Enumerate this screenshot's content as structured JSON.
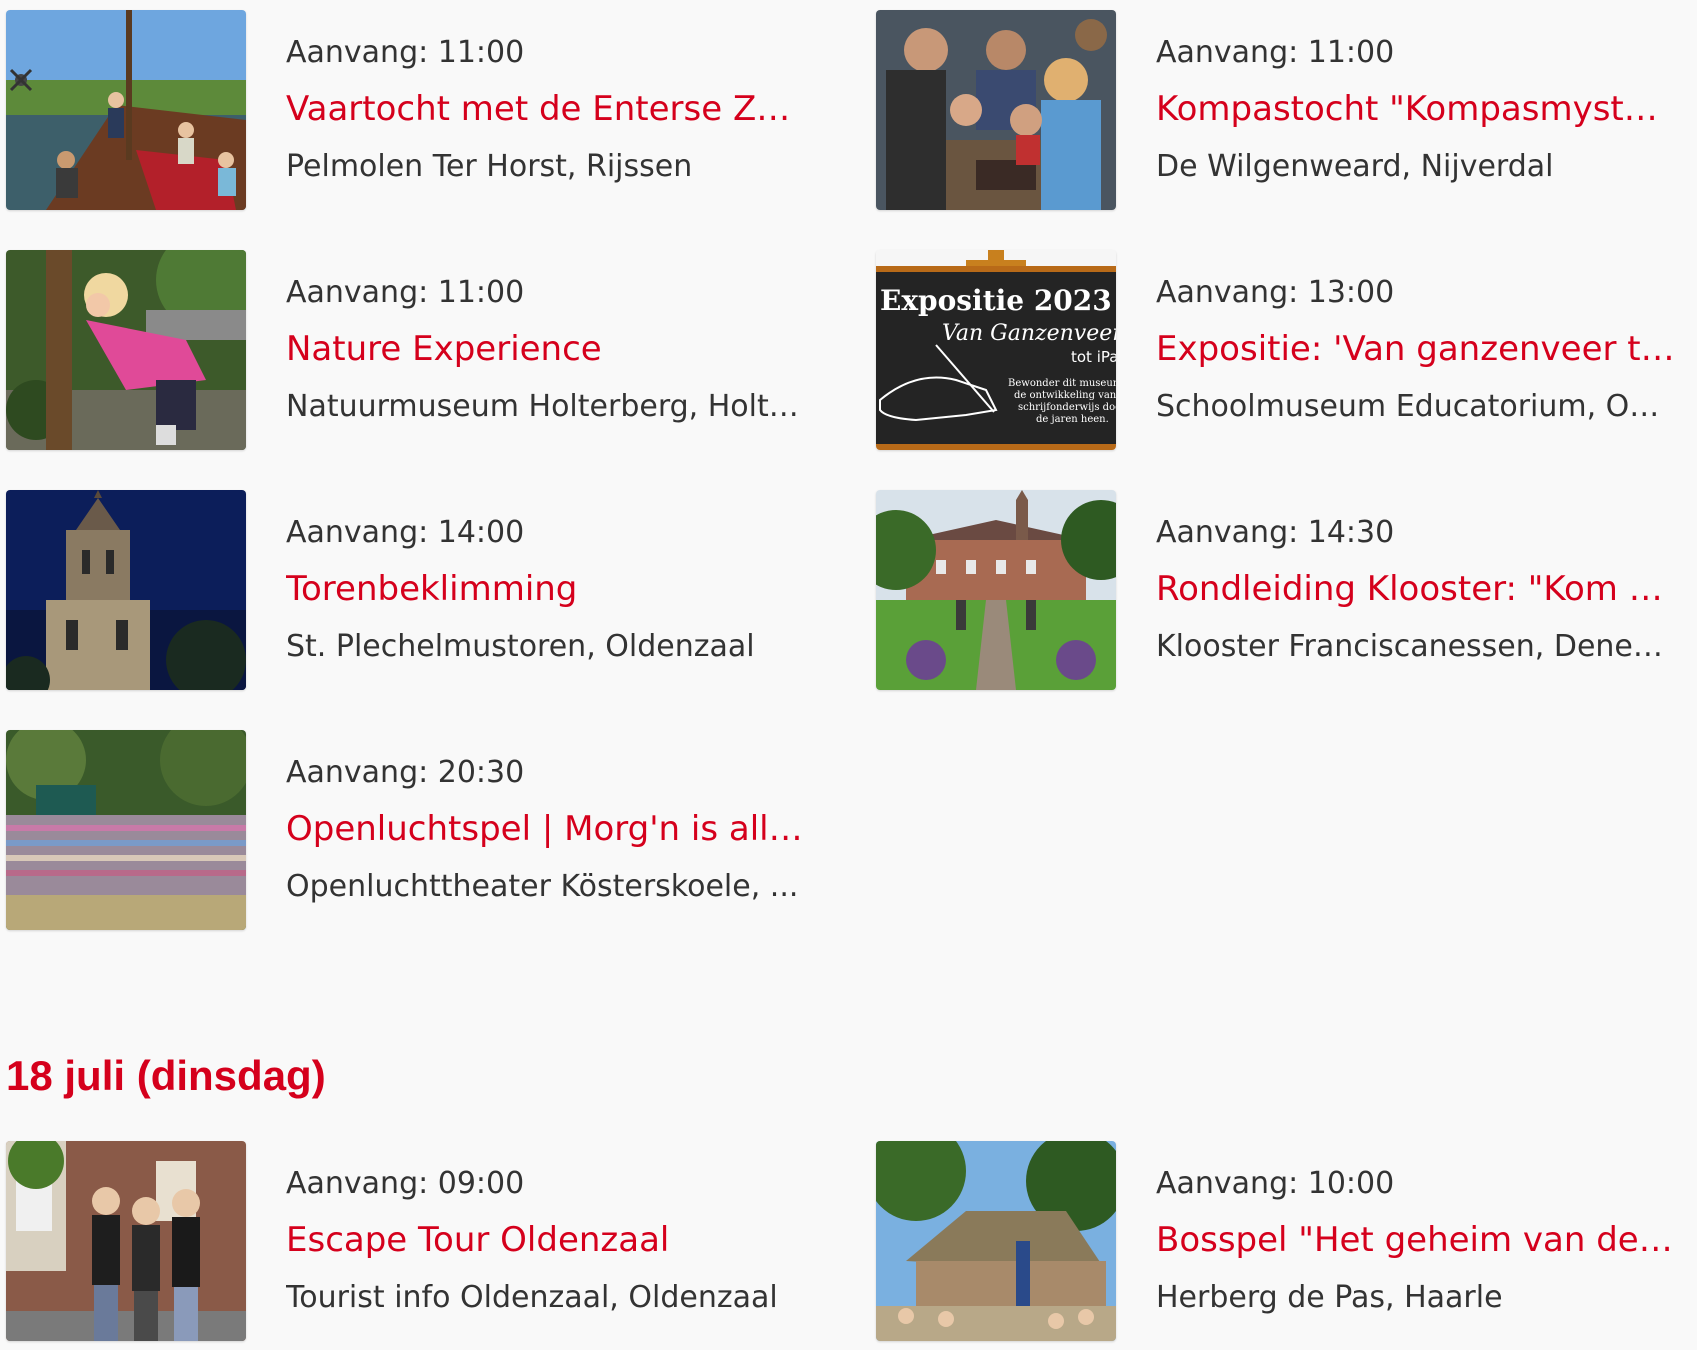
{
  "accent_color": "#d5001c",
  "text_color": "#333333",
  "days": [
    {
      "heading": "",
      "events": [
        {
          "time": "Aanvang: 11:00",
          "title": "Vaartocht met de Enterse Zomp",
          "venue": "Pelmolen Ter Horst, Rijssen",
          "image": "boat-photo"
        },
        {
          "time": "Aanvang: 11:00",
          "title": "Kompastocht \"Kompasmysteri...",
          "venue": "De Wilgenweard, Nijverdal",
          "image": "group-photo"
        },
        {
          "time": "Aanvang: 11:00",
          "title": "Nature Experience",
          "venue": "Natuurmuseum Holterberg, Holten",
          "image": "child-tree-photo"
        },
        {
          "time": "Aanvang: 13:00",
          "title": "Expositie: 'Van ganzenveer to...",
          "venue": "Schoolmuseum Educatorium, Oot...",
          "image": "chalkboard-photo"
        },
        {
          "time": "Aanvang: 14:00",
          "title": "Torenbeklimming",
          "venue": "St. Plechelmustoren, Oldenzaal",
          "image": "tower-photo"
        },
        {
          "time": "Aanvang: 14:30",
          "title": "Rondleiding Klooster: \"Kom e...",
          "venue": "Klooster Franciscanessen, Denek...",
          "image": "monastery-photo"
        },
        {
          "time": "Aanvang: 20:30",
          "title": "Openluchtspel | Morg'n is alle...",
          "venue": "Openluchttheater Kösterskoele, ...",
          "image": "theater-photo"
        }
      ]
    },
    {
      "heading": "18 juli (dinsdag)",
      "events": [
        {
          "time": "Aanvang: 09:00",
          "title": "Escape Tour Oldenzaal",
          "venue": "Tourist info Oldenzaal, Oldenzaal",
          "image": "girls-photo"
        },
        {
          "time": "Aanvang: 10:00",
          "title": "Bosspel \"Het geheim van de H...",
          "venue": "Herberg de Pas, Haarle",
          "image": "farmhouse-photo"
        }
      ]
    }
  ],
  "chalkboard": {
    "line1": "Expositie 2023",
    "line2": "Van Ganzenveer",
    "line3": "tot iPa",
    "line4": "Bewonder dit museumj",
    "line5": "de ontwikkeling van he",
    "line6": "schrijfonderwijs door",
    "line7": "de jaren heen."
  }
}
